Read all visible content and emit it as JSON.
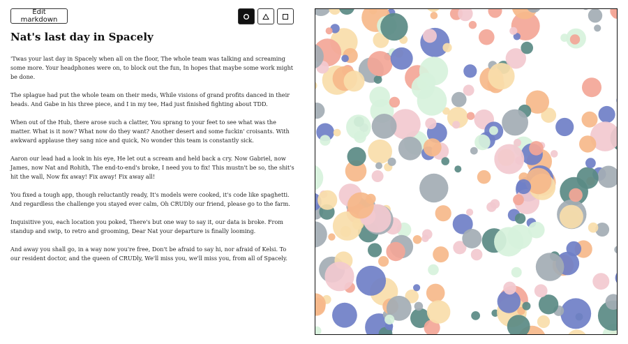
{
  "toolbar": {
    "edit_label": "Edit markdown",
    "shapes": [
      {
        "name": "circle",
        "icon": "circle-icon",
        "active": true
      },
      {
        "name": "triangle",
        "icon": "triangle-icon",
        "active": false
      },
      {
        "name": "square",
        "icon": "square-icon",
        "active": false
      }
    ]
  },
  "document": {
    "title": "Nat's last day in Spacely",
    "paragraphs": [
      "'Twas your last day in Spacely when all on the floor, The whole team was talking and screaming some more. Your headphones were on, to block out the fun, In hopes that maybe some work might be done.",
      "The splague had put the whole team on their meds, While visions of grand profits danced in their heads. And Gabe in his three piece, and I in my tee, Had just finished fighting about TDD.",
      "When out of the Hub, there arose such a clatter, You sprang to your feet to see what was the matter. What is it now? What now do they want? Another desert and some fuckin' croisants. With awkward applause they sang nice and quick, No wonder this team is constantly sick.",
      "Aaron our lead had a look in his eye, He let out a scream and held back a cry. Now Gabriel, now James, now Nat and Rohith, The end-to-end's broke, I need you to fix! This mustn't be so, the shit's hit the wall, Now fix away! Fix away! Fix away all!",
      "You fixed a tough app, though reluctantly ready, It's models were cooked, it's code like spaghetti. And regardless the challenge you stayed ever calm, Oh CRUDly our friend, please go to the farm.",
      "Inquisitive you, each location you poked, There's but one way to say it, our data is broke. From standup and swip, to retro and grooming, Dear Nat your departure is finally looming.",
      "And away you shall go, in a way now you're free, Don't be afraid to say hi, nor afraid of Kelsi. To our resident doctor, and the queen of CRUDly, We'll miss you, we'll miss you, from all of Spacely."
    ]
  },
  "palette": [
    "#5a8a84",
    "#6f7fc7",
    "#a3adb4",
    "#f2c9cf",
    "#f3a697",
    "#d7f2dc",
    "#f9ddaa",
    "#f6b98a"
  ]
}
